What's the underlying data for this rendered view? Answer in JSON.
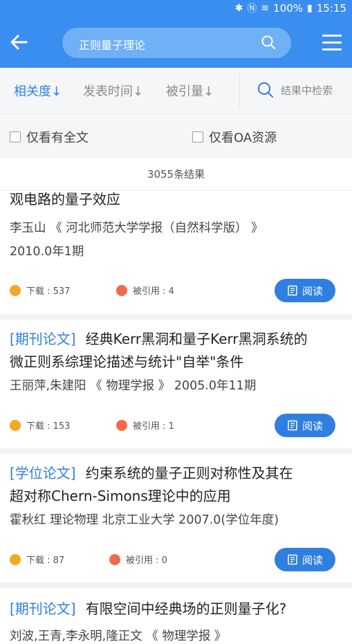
{
  "status": {
    "battery": "100%",
    "time": "15:15"
  },
  "header": {
    "query": "正则量子理论"
  },
  "sort": {
    "relevance": "相关度↓",
    "date": "发表时间↓",
    "citations": "被引量↓",
    "search_in_results": "结果中检索"
  },
  "filters": {
    "full_text": "仅看有全文",
    "oa": "仅看OA资源"
  },
  "results_count": "3055条结果",
  "items": [
    {
      "type": "",
      "title": "观电路的量子效应",
      "meta": "李玉山  《 河北师范大学学报（自然科学版） 》",
      "meta2": "2010.0年1期",
      "downloads": "下载 : 537",
      "citations": "被引用 : 4",
      "read": "阅读"
    },
    {
      "type": "[期刊论文]",
      "title_line1": "经典Kerr黑洞和量子Kerr黑洞系统的",
      "title_line2": "微正则系综理论描述与统计\"自举\"条件",
      "meta": "王丽萍,朱建阳   《 物理学报 》   2005.0年11期",
      "downloads": "下载 : 153",
      "citations": "被引用 : 1",
      "read": "阅读"
    },
    {
      "type": "[学位论文]",
      "title_line1": "约束系统的量子正则对称性及其在",
      "title_line2": "超对称Chern-Simons理论中的应用",
      "meta": "霍秋红    理论物理 北京工业大学    2007.0(学位年度)",
      "downloads": "下载 : 87",
      "citations": "被引用 : 0",
      "read": "阅读"
    },
    {
      "type": "[期刊论文]",
      "title_line1": "有限空间中经典场的正则量子化?",
      "meta": "刘波,王青,李永明,隆正文    《 物理学报 》"
    }
  ]
}
